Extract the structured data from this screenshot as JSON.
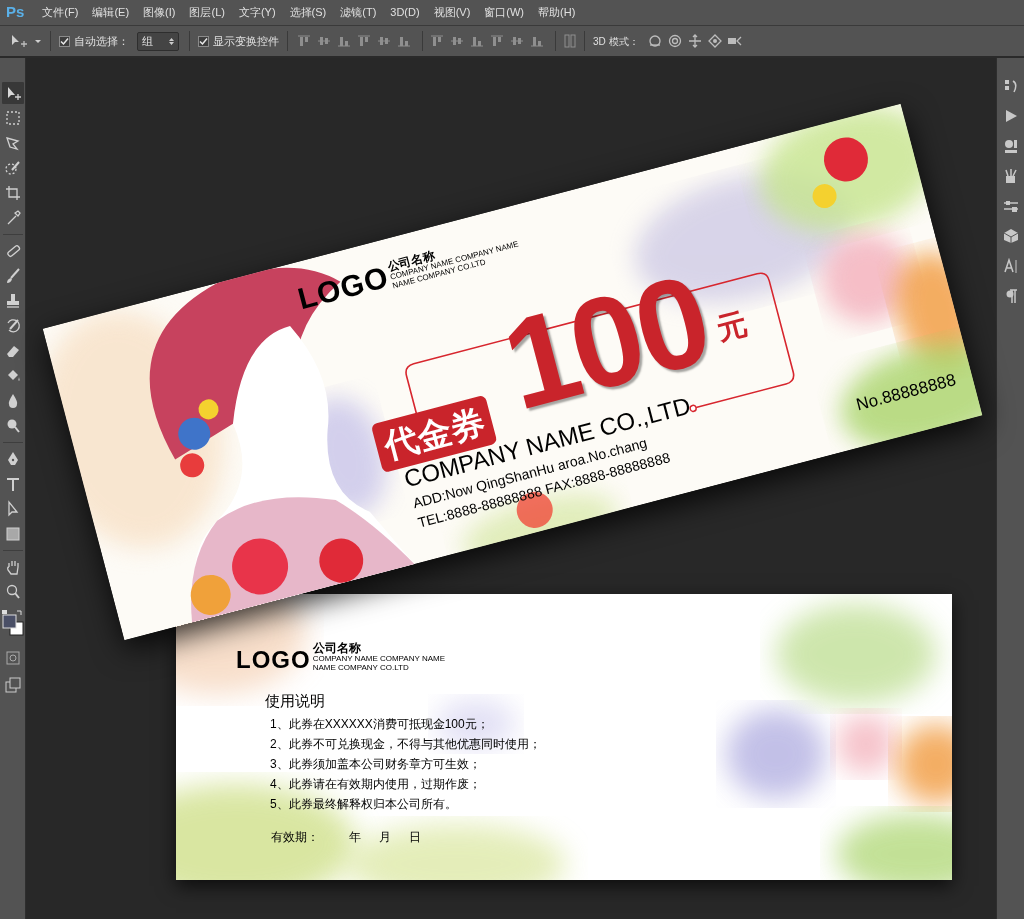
{
  "app": {
    "logo": "Ps"
  },
  "menu": [
    "文件(F)",
    "编辑(E)",
    "图像(I)",
    "图层(L)",
    "文字(Y)",
    "选择(S)",
    "滤镜(T)",
    "3D(D)",
    "视图(V)",
    "窗口(W)",
    "帮助(H)"
  ],
  "options_bar": {
    "auto_select": {
      "label": "自动选择：",
      "checked": true
    },
    "select_value": "组",
    "show_transform": {
      "label": "显示变换控件",
      "checked": true
    },
    "mode_label": "3D 模式："
  },
  "left_tools": [
    {
      "selected": true
    },
    {
      "selected": false
    },
    {
      "selected": false
    },
    {
      "selected": false
    },
    {
      "selected": false
    },
    {
      "selected": false
    },
    {
      "selected": false
    },
    {
      "selected": false
    },
    {
      "selected": false
    },
    {
      "selected": false
    },
    {
      "selected": false
    },
    {
      "selected": false
    },
    {
      "selected": false
    },
    {
      "selected": false
    },
    {
      "selected": false
    },
    {
      "selected": false
    },
    {
      "selected": false
    },
    {
      "selected": false
    },
    {
      "selected": false
    },
    {
      "selected": false
    }
  ],
  "front_voucher": {
    "logo": "LOGO",
    "company_cn": "公司名称",
    "company_en_1": "COMPANY NAME COMPANY NAME",
    "company_en_2": "NAME COMPANY CO.LTD",
    "badge": "代金券",
    "amount": "100",
    "unit": "元",
    "company_name": "COMPANY NAME CO.,LTD",
    "address": "ADD:Now QingShanHu aroa.No.chang",
    "phone": "TEL:8888-88888888  FAX:8888-88888888",
    "serial": "No.88888888"
  },
  "back_voucher": {
    "logo": "LOGO",
    "company_cn": "公司名称",
    "company_en_1": "COMPANY NAME COMPANY NAME",
    "company_en_2": "NAME COMPANY CO.LTD",
    "heading": "使用说明",
    "rules": [
      "1、此券在XXXXXX消费可抵现金100元；",
      "2、此券不可兑换现金，不得与其他优惠同时使用；",
      "3、此券须加盖本公司财务章方可生效；",
      "4、此券请在有效期内使用，过期作废；",
      "5、此券最终解释权归本公司所有。"
    ],
    "validity_label": "有效期：",
    "year": "年",
    "month": "月",
    "day": "日"
  }
}
